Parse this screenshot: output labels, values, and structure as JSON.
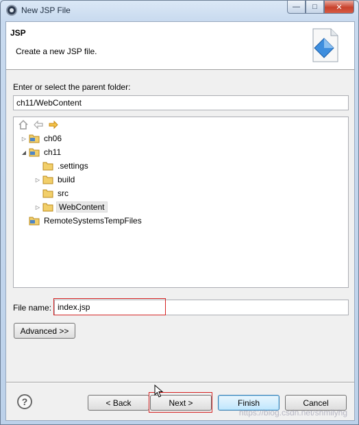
{
  "window": {
    "title": "New JSP File"
  },
  "header": {
    "title": "JSP",
    "description": "Create a new JSP file."
  },
  "parent_folder": {
    "label": "Enter or select the parent folder:",
    "value": "ch11/WebContent"
  },
  "tree": {
    "items": [
      {
        "label": "ch06",
        "expanded": false,
        "has_children": true,
        "type": "project"
      },
      {
        "label": "ch11",
        "expanded": true,
        "has_children": true,
        "type": "project"
      },
      {
        "label": ".settings",
        "has_children": false,
        "type": "folder"
      },
      {
        "label": "build",
        "has_children": true,
        "type": "folder"
      },
      {
        "label": "src",
        "has_children": false,
        "type": "folder"
      },
      {
        "label": "WebContent",
        "has_children": true,
        "type": "folder",
        "selected": true
      },
      {
        "label": "RemoteSystemsTempFiles",
        "has_children": false,
        "type": "project"
      }
    ]
  },
  "file_name": {
    "label": "File name:",
    "value": "index.jsp"
  },
  "buttons": {
    "advanced": "Advanced >>",
    "back": "< Back",
    "next": "Next >",
    "finish": "Finish",
    "cancel": "Cancel",
    "help": "?"
  },
  "watermark": "https://blog.csdn.net/shmilyhg",
  "colors": {
    "highlight_box": "#d42020",
    "folder": "#e8b33c",
    "project": "#4f86c6"
  }
}
